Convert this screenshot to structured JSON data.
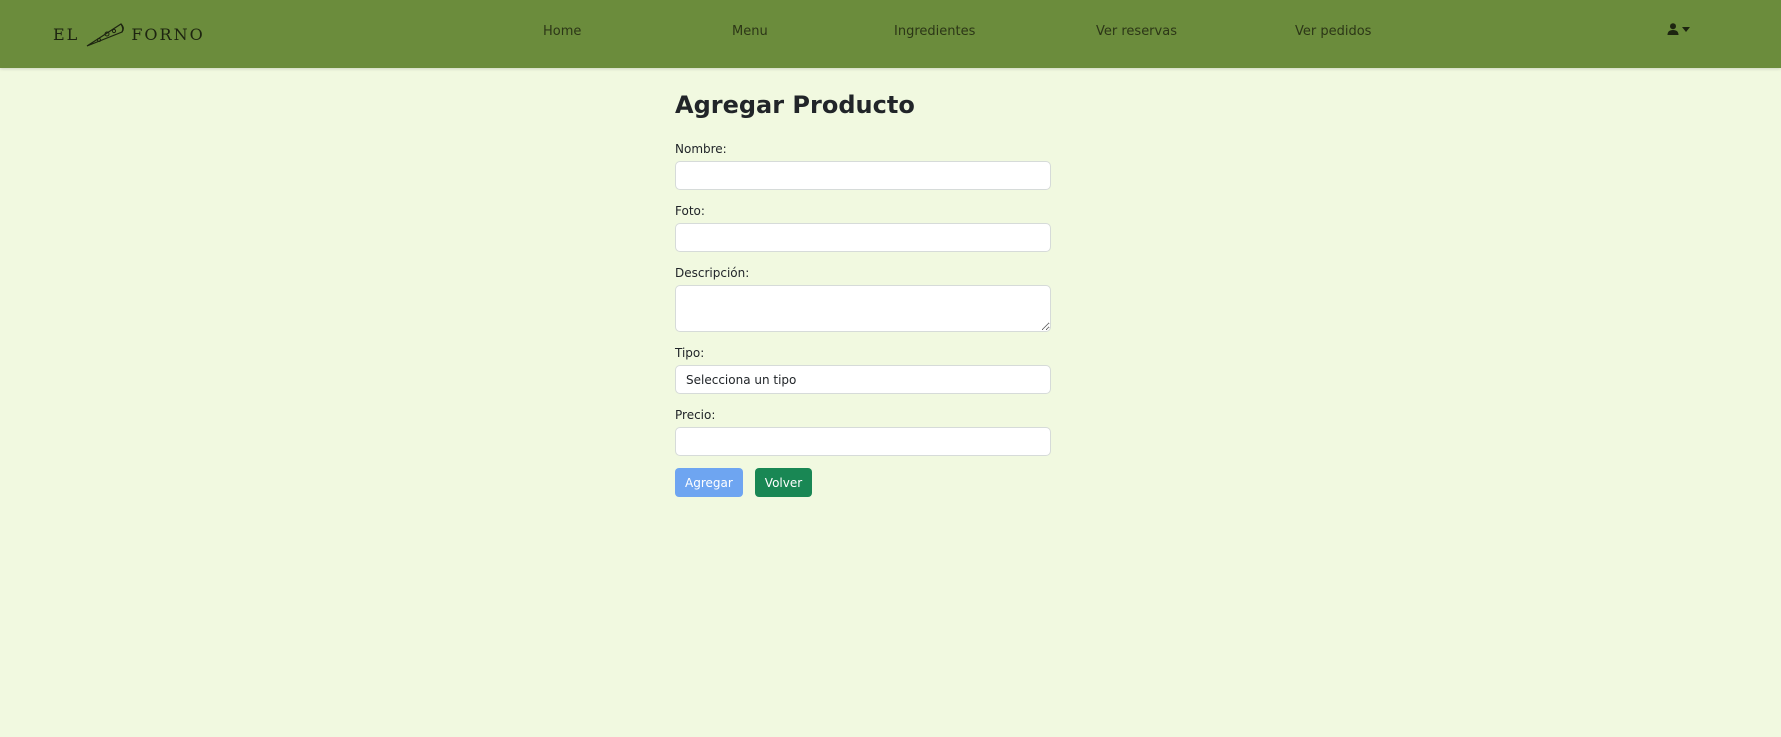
{
  "brand": {
    "left": "EL",
    "right": "FORNO"
  },
  "nav": {
    "items": [
      {
        "label": "Home"
      },
      {
        "label": "Menu"
      },
      {
        "label": "Ingredientes"
      },
      {
        "label": "Ver reservas"
      },
      {
        "label": "Ver pedidos"
      }
    ],
    "user_icon": "user-icon",
    "caret_icon": "caret-down-icon"
  },
  "form": {
    "title": "Agregar Producto",
    "nombre": {
      "label": "Nombre:",
      "value": ""
    },
    "foto": {
      "label": "Foto:",
      "value": ""
    },
    "descripcion": {
      "label": "Descripción:",
      "value": ""
    },
    "tipo": {
      "label": "Tipo:",
      "selected": "Selecciona un tipo"
    },
    "precio": {
      "label": "Precio:",
      "value": ""
    },
    "submit_label": "Agregar",
    "back_label": "Volver"
  },
  "colors": {
    "navbar": "#6b8c3c",
    "background": "#f1f9e0",
    "primary_button": "#6ea5f1",
    "success_button": "#198754"
  }
}
